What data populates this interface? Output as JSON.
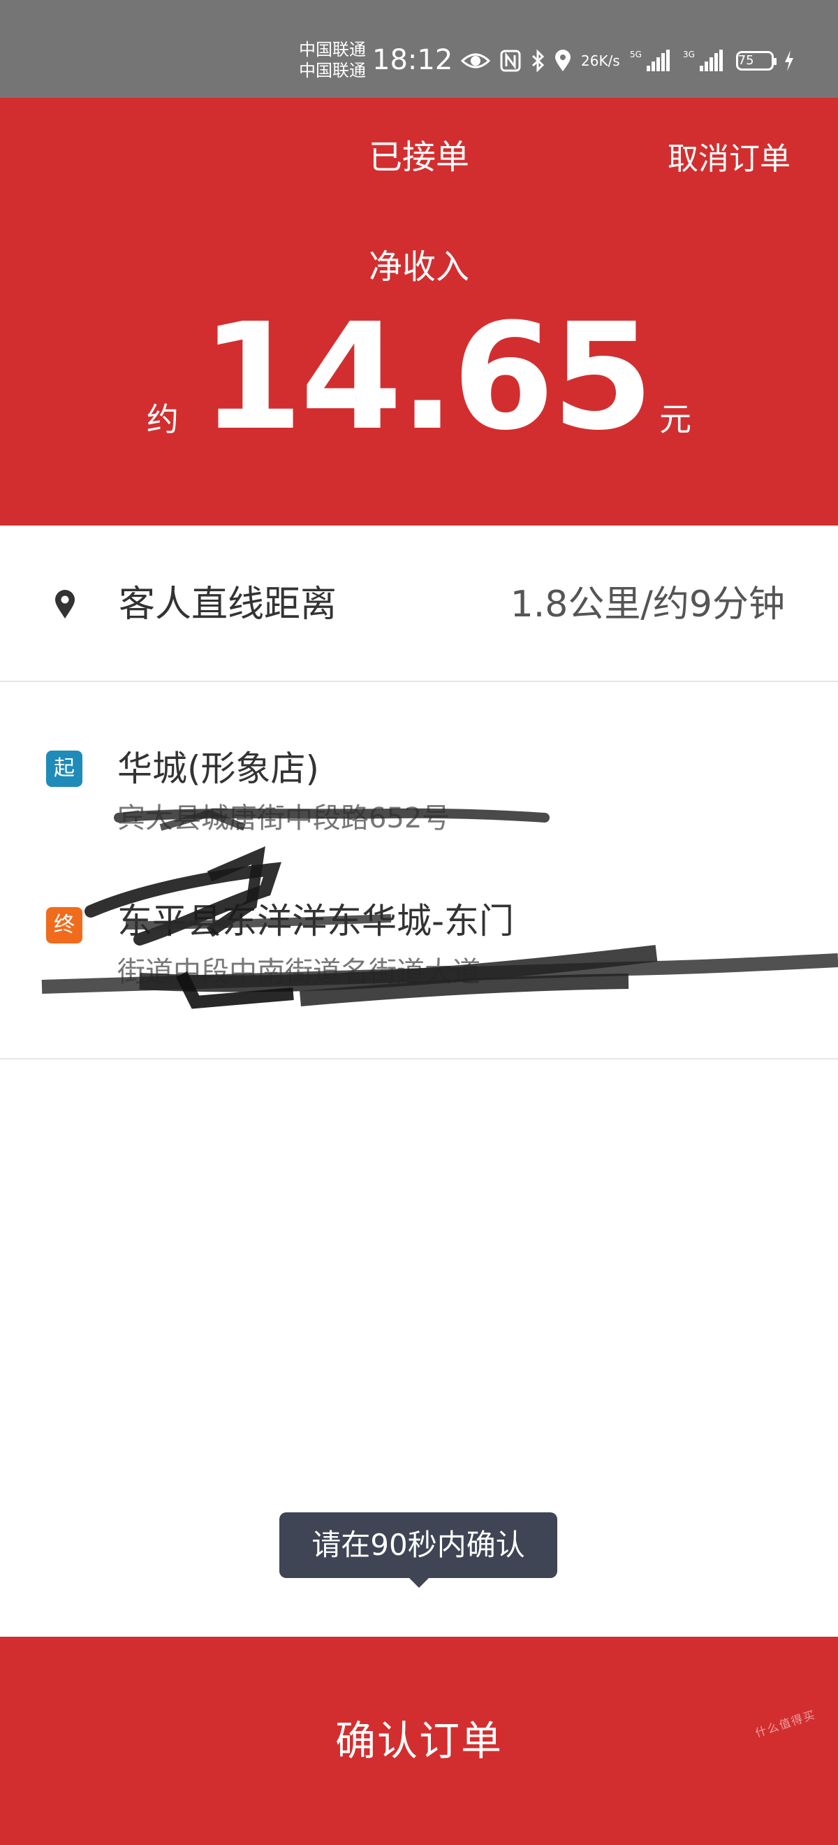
{
  "status_bar": {
    "carrier_1": "中国联通",
    "carrier_2": "中国联通",
    "time": "18:12",
    "net_speed_value": "26",
    "net_speed_unit": "K/s",
    "signal_1_label": "5G",
    "signal_2_label": "3G",
    "battery": "75",
    "icons": [
      "eye-comfort-icon",
      "nfc-icon",
      "bluetooth-icon",
      "location-icon",
      "signal-5g-icon",
      "signal-3g-icon",
      "battery-icon",
      "charging-icon"
    ]
  },
  "header": {
    "status": "已接单",
    "cancel_label": "取消订单",
    "income_label": "净收入",
    "approx_label": "约",
    "amount": "14.65",
    "unit": "元",
    "background_color": "#d32e2f"
  },
  "distance": {
    "icon": "location-pin-icon",
    "label": "客人直线距离",
    "value": "1.8公里/约9分钟"
  },
  "route": {
    "start": {
      "tag": "起",
      "tag_color": "#1f8bb8",
      "name": "华城(形象店)",
      "detail": "宾大县城唐街中段路652号"
    },
    "end": {
      "tag": "终",
      "tag_color": "#f16b1c",
      "name": "东平县东洋洋东华城-东门",
      "detail": "街道中段中南街道名街道大道"
    }
  },
  "tooltip": {
    "text": "请在90秒内确认"
  },
  "footer": {
    "confirm_label": "确认订单",
    "watermark": "什么值得买"
  }
}
